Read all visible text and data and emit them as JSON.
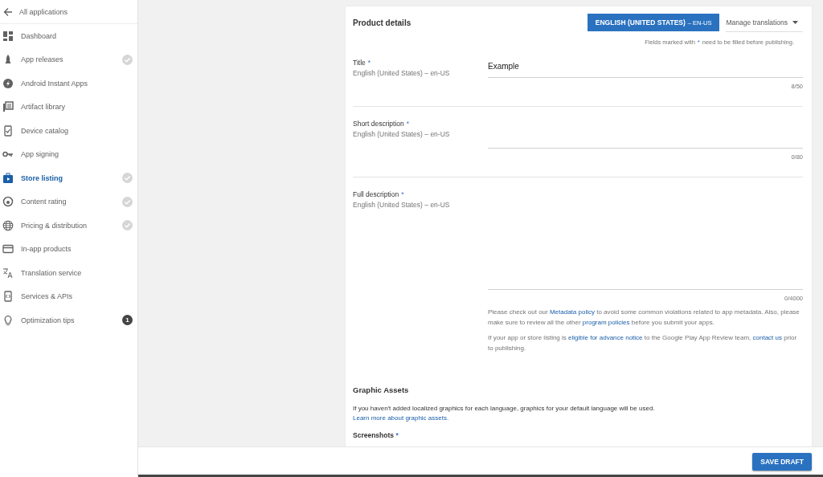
{
  "sidebar": {
    "back": {
      "label": "All applications"
    },
    "items": [
      {
        "label": "Dashboard",
        "selected": false,
        "completed": false
      },
      {
        "label": "App releases",
        "selected": false,
        "completed": true
      },
      {
        "label": "Android Instant Apps",
        "selected": false,
        "completed": false
      },
      {
        "label": "Artifact library",
        "selected": false,
        "completed": false
      },
      {
        "label": "Device catalog",
        "selected": false,
        "completed": false
      },
      {
        "label": "App signing",
        "selected": false,
        "completed": false
      },
      {
        "label": "Store listing",
        "selected": true,
        "completed": true
      },
      {
        "label": "Content rating",
        "selected": false,
        "completed": true
      },
      {
        "label": "Pricing & distribution",
        "selected": false,
        "completed": true
      },
      {
        "label": "In-app products",
        "selected": false,
        "completed": false
      },
      {
        "label": "Translation service",
        "selected": false,
        "completed": false
      },
      {
        "label": "Services & APIs",
        "selected": false,
        "completed": false
      },
      {
        "label": "Optimization tips",
        "selected": false,
        "completed": false,
        "badge": "1"
      }
    ]
  },
  "product_details": {
    "title": "Product details",
    "language_button": {
      "label": "ENGLISH (UNITED STATES)",
      "code": "– EN-US"
    },
    "manage_translations": "Manage translations",
    "required_note": {
      "before": "Fields marked with",
      "mark": "*",
      "after": "need to be filled before publishing."
    },
    "fields": [
      {
        "label": "Title",
        "required": true,
        "language": "English (United States) – en-US",
        "value": "Example",
        "counter": "8/50",
        "kind": "single"
      },
      {
        "label": "Short description",
        "required": true,
        "language": "English (United States) – en-US",
        "counter": "0/80",
        "kind": "single"
      },
      {
        "label": "Full description",
        "required": true,
        "language": "English (United States) – en-US",
        "counter": "0/4000",
        "kind": "multi"
      }
    ],
    "notes": [
      [
        {
          "kind": "text",
          "text": "Please check out our "
        },
        {
          "kind": "link",
          "text": "Metadata policy"
        },
        {
          "kind": "text",
          "text": " to avoid some common violations related to app metadata. Also, please make sure to review all the other "
        },
        {
          "kind": "link",
          "text": "program policies"
        },
        {
          "kind": "text",
          "text": " before you submit your apps."
        }
      ],
      [
        {
          "kind": "text",
          "text": "If your app or store listing is "
        },
        {
          "kind": "link",
          "text": "eligible for advance notice"
        },
        {
          "kind": "text",
          "text": " to the Google Play App Review team, "
        },
        {
          "kind": "link",
          "text": "contact us"
        },
        {
          "kind": "text",
          "text": " prior to publishing."
        }
      ]
    ]
  },
  "graphic_assets": {
    "title": "Graphic Assets",
    "description": "If you haven't added localized graphics for each language, graphics for your default language will be used.",
    "link": "Learn more about graphic assets.",
    "screenshots_label": "Screenshots",
    "screenshots_required": true
  },
  "footer": {
    "save_button": "SAVE DRAFT"
  }
}
